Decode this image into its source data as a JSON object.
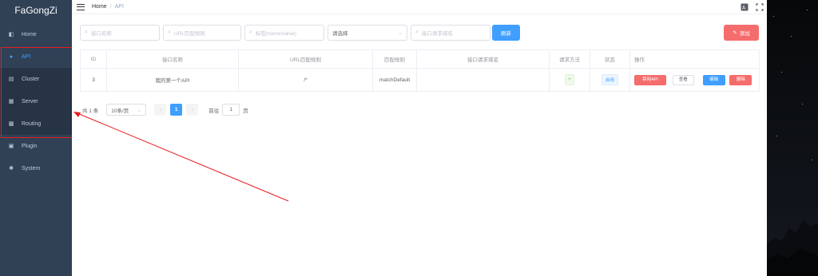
{
  "app": {
    "logo": "FaGongZi"
  },
  "sidebar": {
    "items": [
      {
        "label": "Home",
        "icon": "dashboard-icon"
      },
      {
        "label": "API",
        "icon": "globe-icon"
      },
      {
        "label": "Cluster",
        "icon": "document-icon"
      },
      {
        "label": "Server",
        "icon": "server-icon"
      },
      {
        "label": "Routing",
        "icon": "grid-icon"
      },
      {
        "label": "Plugin",
        "icon": "plugin-icon"
      },
      {
        "label": "System",
        "icon": "settings-icon"
      }
    ]
  },
  "breadcrumb": {
    "home": "Home",
    "separator": "/",
    "current": "API"
  },
  "filters": {
    "name_placeholder": "接口名称",
    "url_placeholder": "URL匹配规则",
    "tag_placeholder": "标签(name/value)",
    "select_value": "请选择",
    "domain_placeholder": "接口请求域名",
    "refresh_label": "刷新",
    "add_label": "添加"
  },
  "table": {
    "headers": [
      "ID",
      "接口名称",
      "URL匹配规则",
      "匹配规则",
      "接口请求域名",
      "请求方法",
      "状态",
      "操作"
    ],
    "rows": [
      {
        "id": "3",
        "name": "我的第一个API",
        "url": "/*",
        "match": "matchDefault",
        "domain": "",
        "method": "+",
        "status": "启用",
        "actions": [
          "禁用API",
          "查看",
          "编辑",
          "删除"
        ]
      }
    ]
  },
  "pagination": {
    "total": "共 1 条",
    "page_size": "10条/页",
    "prev": "‹",
    "current": "1",
    "next": "›",
    "goto_label": "前往",
    "goto_value": "1",
    "page_suffix": "页"
  },
  "colors": {
    "sidebar_bg": "#304156",
    "primary": "#409eff",
    "danger": "#f56c6c",
    "annotation": "#e81c1c"
  }
}
